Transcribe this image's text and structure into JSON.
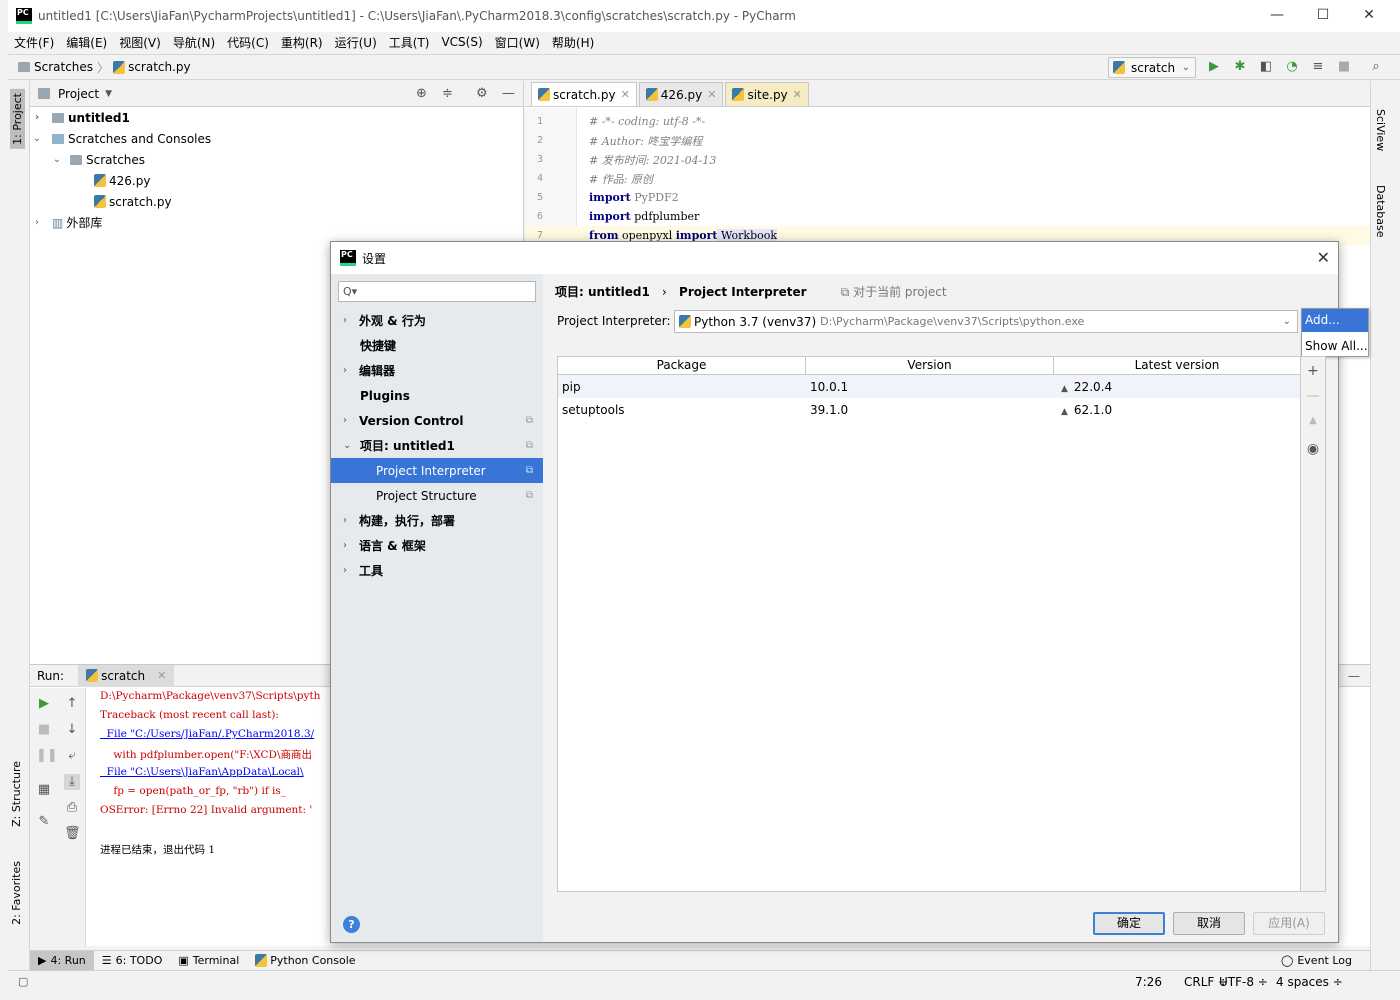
{
  "window": {
    "title": "untitled1 [C:\\Users\\JiaFan\\PycharmProjects\\untitled1] - C:\\Users\\JiaFan\\.PyCharm2018.3\\config\\scratches\\scratch.py - PyCharm",
    "app_icon": "PC"
  },
  "menu": [
    "文件(F)",
    "编辑(E)",
    "视图(V)",
    "导航(N)",
    "代码(C)",
    "重构(R)",
    "运行(U)",
    "工具(T)",
    "VCS(S)",
    "窗口(W)",
    "帮助(H)"
  ],
  "navbar": {
    "crumb1": "Scratches",
    "crumb2": "scratch.py",
    "run_config": "scratch"
  },
  "left_tabs": {
    "project": "1: Project",
    "structure": "Z: Structure",
    "favorites": "2: Favorites"
  },
  "right_tabs": {
    "sciview": "SciView",
    "database": "Database"
  },
  "project": {
    "header": "Project",
    "tree": [
      {
        "label": "untitled1",
        "arrow": "›"
      },
      {
        "label": "Scratches and Consoles",
        "arrow": "⌄"
      },
      {
        "label": "Scratches",
        "arrow": "⌄"
      },
      {
        "label": "426.py"
      },
      {
        "label": "scratch.py"
      },
      {
        "label": "外部库",
        "arrow": "›"
      }
    ]
  },
  "editor": {
    "tabs": [
      "scratch.py",
      "426.py",
      "site.py"
    ],
    "lines": [
      {
        "n": "1",
        "text": "# -*- coding: utf-8 -*-"
      },
      {
        "n": "2",
        "text": "# Author: 咚宝学编程"
      },
      {
        "n": "3",
        "text": "# 发布时间: 2021-04-13"
      },
      {
        "n": "4",
        "text": "# 作品: 原创"
      },
      {
        "n": "5",
        "kw": "import",
        "rest": " PyPDF2"
      },
      {
        "n": "6",
        "kw": "import",
        "rest": " pdfplumber"
      },
      {
        "n": "7",
        "kw": "from",
        "mid": " openpyxl ",
        "kw2": "import",
        "rest": " Workbook"
      }
    ]
  },
  "run": {
    "label": "Run:",
    "tab": "scratch",
    "console": [
      "D:\\Pycharm\\Package\\venv37\\Scripts\\pyth",
      "Traceback (most recent call last):",
      "  File \"C:/Users/JiaFan/.PyCharm2018.3/",
      "    with pdfplumber.open(\"F:\\XCD\\商商出",
      "  File \"C:\\Users\\JiaFan\\AppData\\Local\\",
      "    fp = open(path_or_fp, \"rb\") if is_",
      "OSError: [Errno 22] Invalid argument: '",
      "",
      "进程已结束，退出代码 1"
    ]
  },
  "bottom_tabs": [
    "4: Run",
    "6: TODO",
    "Terminal",
    "Python Console"
  ],
  "status": {
    "position": "7:26",
    "line_sep": "CRLF ÷",
    "encoding": "UTF-8 ÷",
    "indent": "4 spaces ÷",
    "event_log": "Event Log"
  },
  "dialog": {
    "title": "设置",
    "search_placeholder": "Q▾",
    "nav": [
      {
        "label": "外观 & 行为",
        "arrow": "›"
      },
      {
        "label": "快捷键"
      },
      {
        "label": "编辑器",
        "arrow": "›"
      },
      {
        "label": "Plugins"
      },
      {
        "label": "Version Control",
        "arrow": "›"
      },
      {
        "label": "项目: untitled1",
        "arrow": "⌄"
      },
      {
        "label": "Project Interpreter"
      },
      {
        "label": "Project Structure"
      },
      {
        "label": "构建，执行，部署",
        "arrow": "›"
      },
      {
        "label": "语言 & 框架",
        "arrow": "›"
      },
      {
        "label": "工具",
        "arrow": "›"
      }
    ],
    "breadcrumb": {
      "parent": "项目: untitled1",
      "current": "Project Interpreter",
      "for_project": "对于当前 project"
    },
    "interpreter_label": "Project Interpreter:",
    "interpreter_name": "Python 3.7 (venv37)",
    "interpreter_path": "D:\\Pycharm\\Package\\venv37\\Scripts\\python.exe",
    "popup": [
      "Add...",
      "Show All..."
    ],
    "table": {
      "columns": [
        "Package",
        "Version",
        "Latest version"
      ],
      "rows": [
        {
          "package": "pip",
          "version": "10.0.1",
          "latest": "22.0.4"
        },
        {
          "package": "setuptools",
          "version": "39.1.0",
          "latest": "62.1.0"
        }
      ]
    },
    "buttons": {
      "ok": "确定",
      "cancel": "取消",
      "apply": "应用(A)"
    }
  }
}
